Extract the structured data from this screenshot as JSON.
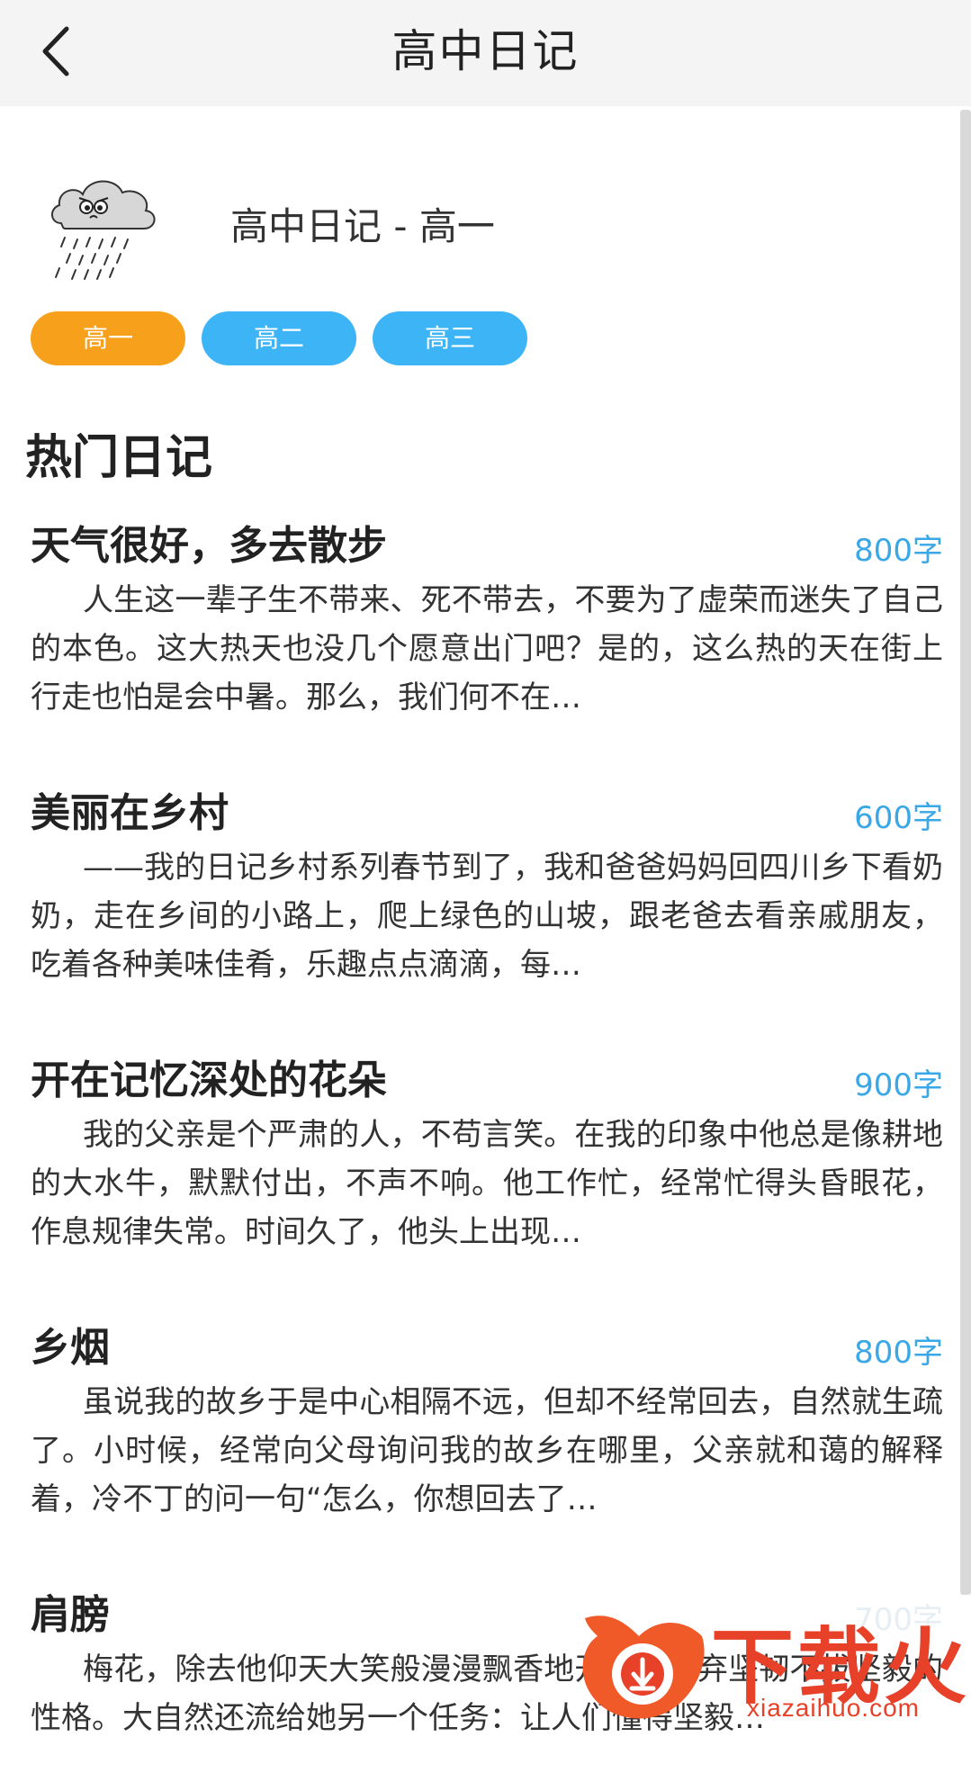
{
  "header": {
    "title": "高中日记"
  },
  "book": {
    "title": "高中日记 - 高一"
  },
  "grades": [
    {
      "label": "高一",
      "active": true
    },
    {
      "label": "高二",
      "active": false
    },
    {
      "label": "高三",
      "active": false
    }
  ],
  "colors": {
    "grade_active": "#f7a01c",
    "grade_inactive": "#3db4f5",
    "word_count": "#3aa7e6",
    "watermark": "#e8412a"
  },
  "section": {
    "title": "热门日记"
  },
  "entries": [
    {
      "title": "天气很好，多去散步",
      "count": "800字",
      "excerpt": "人生这一辈子生不带来、死不带去，不要为了虚荣而迷失了自己的本色。这大热天也没几个愿意出门吧？是的，这么热的天在街上行走也怕是会中暑。那么，我们何不在…"
    },
    {
      "title": "美丽在乡村",
      "count": "600字",
      "excerpt": "——我的日记乡村系列春节到了，我和爸爸妈妈回四川乡下看奶奶，走在乡间的小路上，爬上绿色的山坡，跟老爸去看亲戚朋友，吃着各种美味佳肴，乐趣点点滴滴，每…"
    },
    {
      "title": "开在记忆深处的花朵",
      "count": "900字",
      "excerpt": "我的父亲是个严肃的人，不苟言笑。在我的印象中他总是像耕地的大水牛，默默付出，不声不响。他工作忙，经常忙得头昏眼花，作息规律失常。时间久了，他头上出现…"
    },
    {
      "title": "乡烟",
      "count": "800字",
      "excerpt": "虽说我的故乡于是中心相隔不远，但却不经常回去，自然就生疏了。小时候，经常向父母询问我的故乡在哪里，父亲就和蔼的解释着，冷不丁的问一句“怎么，你想回去了…"
    },
    {
      "title": "肩膀",
      "count": "700字",
      "excerpt": "梅花，除去他仰天大笑般漫漫飘香地开放，舍弃坚韧不拔坚毅的性格。大自然还流给她另一个任务：让人们懂得坚毅…"
    }
  ],
  "watermark": {
    "logo_text": "下载火",
    "url": "xiazaihuo.com"
  }
}
